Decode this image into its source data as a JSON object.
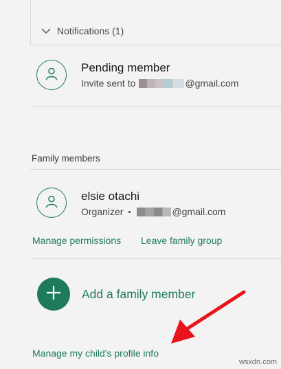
{
  "notifications": {
    "header_label": "Notifications (1)",
    "pending": {
      "name": "Pending member",
      "invite_prefix": "Invite sent to",
      "email_suffix": "@gmail.com"
    }
  },
  "family": {
    "section_title": "Family members",
    "member": {
      "name": "elsie otachi",
      "role": "Organizer",
      "email_suffix": "@gmail.com"
    },
    "manage_permissions": "Manage permissions",
    "leave_group": "Leave family group",
    "add_member": "Add a family member",
    "manage_child_profile": "Manage my child's profile info"
  },
  "watermark": "wsxdn.com",
  "colors": {
    "accent": "#1f7a5c",
    "arrow": "#e8141b",
    "background": "#f3f3f3"
  }
}
